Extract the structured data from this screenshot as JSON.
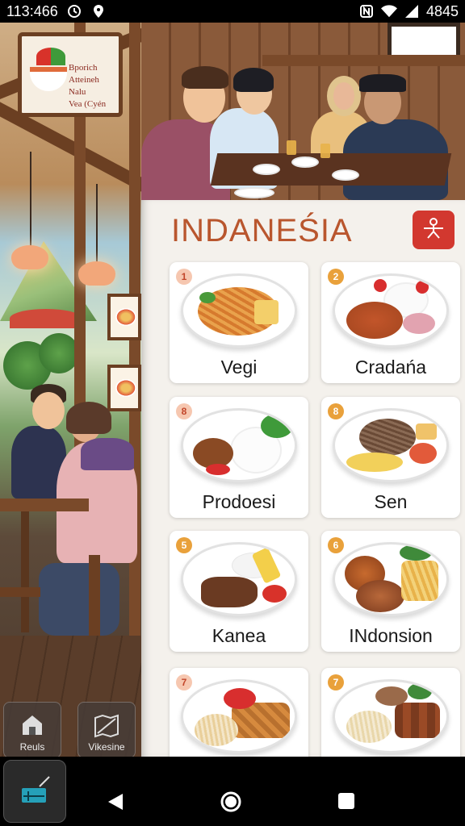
{
  "status_bar": {
    "time": "113:466",
    "right_text": "4845",
    "icons": [
      "clock-icon",
      "location-icon",
      "nfc-icon",
      "wifi-icon",
      "signal-icon"
    ]
  },
  "left_panel": {
    "sign_lines": [
      "Bporich",
      "Atteineh",
      "Nalu",
      "Vea (Cyén"
    ],
    "buttons": [
      {
        "label": "Reuls",
        "icon": "home-icon"
      },
      {
        "label": "Vikesine",
        "icon": "map-icon"
      }
    ]
  },
  "header": {
    "title": "INDANEŚIA",
    "action_icon": "share-icon"
  },
  "menu": {
    "items": [
      {
        "number": "1",
        "label": "Vegi"
      },
      {
        "number": "2",
        "label": "Cradańa"
      },
      {
        "number": "8",
        "label": "Prodoesi"
      },
      {
        "number": "8",
        "label": "Sen"
      },
      {
        "number": "5",
        "label": "Kanea"
      },
      {
        "number": "6",
        "label": "INdonsion"
      },
      {
        "number": "7",
        "label": ""
      },
      {
        "number": "7",
        "label": ""
      }
    ]
  },
  "colors": {
    "accent": "#b9562e",
    "badge": "#e9a13b",
    "action_button": "#d2382f",
    "panel_bg": "#f4f1ec"
  },
  "nav_bar": {
    "icons": [
      "app-switcher-icon",
      "back-icon",
      "home-circle-icon",
      "recents-icon"
    ]
  }
}
